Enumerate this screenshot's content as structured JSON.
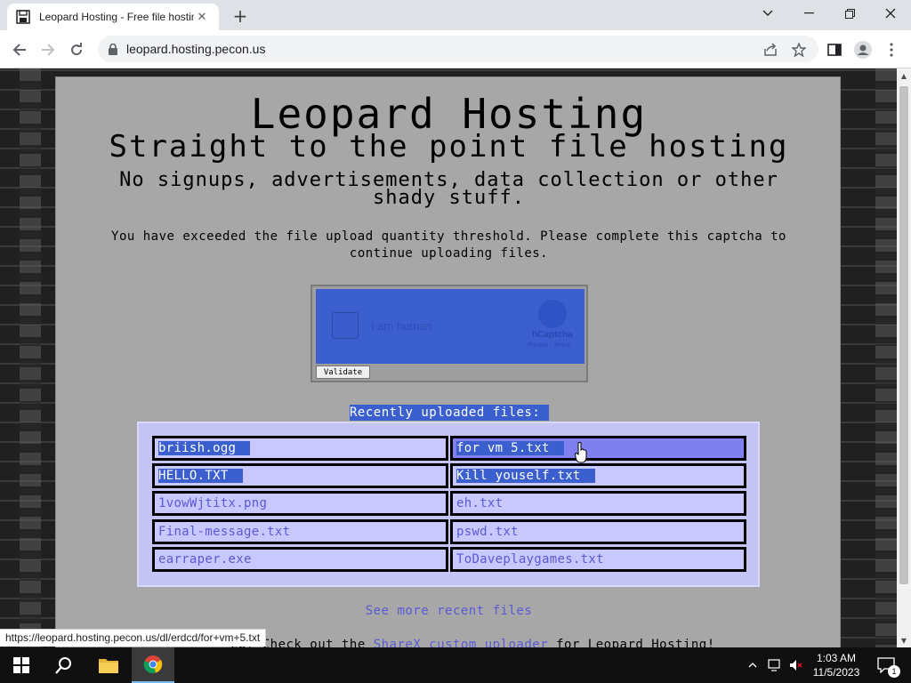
{
  "browser": {
    "tab_title": "Leopard Hosting - Free file hosting",
    "url": "leopard.hosting.pecon.us",
    "status_url": "https://leopard.hosting.pecon.us/dl/erdcd/for+vm+5.txt"
  },
  "page": {
    "title": "Leopard Hosting",
    "subtitle": "Straight to the point file hosting",
    "tagline": "No signups, advertisements, data collection or other shady stuff.",
    "notice": "You have exceeded the file upload quantity threshold. Please complete this captcha to continue uploading files.",
    "captcha": {
      "label": "I am human",
      "brand": "hCaptcha",
      "links": "Privacy - Terms",
      "validate_label": "Validate"
    },
    "recent_title": "Recently uploaded files:",
    "files": [
      {
        "name": "briish.ogg",
        "selected": true
      },
      {
        "name": "for vm 5.txt",
        "selected": true
      },
      {
        "name": "HELLO.TXT",
        "selected": true
      },
      {
        "name": "Kill youself.txt",
        "selected": true
      },
      {
        "name": "1vowWjtitx.png",
        "selected": false
      },
      {
        "name": "eh.txt",
        "selected": false
      },
      {
        "name": "Final-message.txt",
        "selected": false
      },
      {
        "name": "pswd.txt",
        "selected": false
      },
      {
        "name": "earraper.exe",
        "selected": false
      },
      {
        "name": "ToDaveplaygames.txt",
        "selected": false
      }
    ],
    "see_more": "See more recent files",
    "bottom_prefix": "ep? Check out the ",
    "bottom_link": "ShareX custom uploader",
    "bottom_suffix": " for Leopard Hosting!"
  },
  "taskbar": {
    "time": "1:03 AM",
    "date": "11/5/2023",
    "notification_count": "1"
  },
  "colors": {
    "selection": "#3b5fcf",
    "file_bg": "#c8c8ff",
    "file_text": "#5a5ad6",
    "card_bg": "#a7a7a7"
  }
}
